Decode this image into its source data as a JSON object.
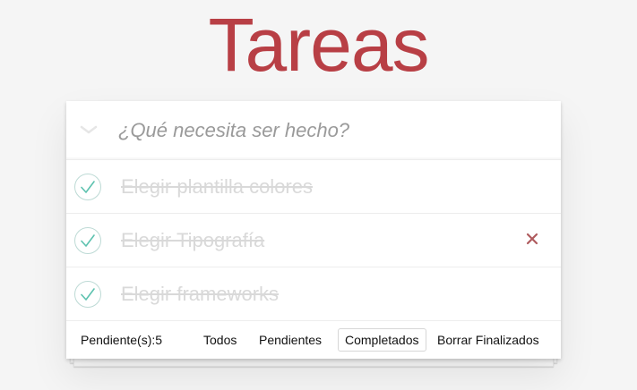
{
  "app": {
    "title": "Tareas",
    "accent_color": "#b83f45",
    "check_color": "#5dc2af",
    "destroy_color": "#af5b5e"
  },
  "header": {
    "toggle_all_icon": "chevron-down-icon",
    "new_todo_placeholder": "¿Qué necesita ser hecho?"
  },
  "todos": [
    {
      "label": "Elegir plantilla colores",
      "completed": true
    },
    {
      "label": "Elegir Tipografía",
      "completed": true,
      "hover_destroy_visible": true
    },
    {
      "label": "Elegir frameworks",
      "completed": true
    }
  ],
  "footer": {
    "count_text": "Pendiente(s):5",
    "filters": [
      {
        "label": "Todos",
        "selected": false
      },
      {
        "label": "Pendientes",
        "selected": false
      },
      {
        "label": "Completados",
        "selected": true
      }
    ],
    "clear_label": "Borrar Finalizados"
  }
}
